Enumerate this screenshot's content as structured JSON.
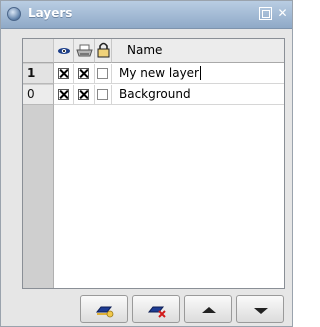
{
  "window": {
    "title": "Layers"
  },
  "table": {
    "columns": {
      "visible_icon": "eye-icon",
      "print_icon": "printer-icon",
      "lock_icon": "lock-icon",
      "name": "Name"
    },
    "rows": [
      {
        "index": "1",
        "visible": true,
        "printable": true,
        "locked": false,
        "name": "My new layer",
        "editing": true,
        "selected": true
      },
      {
        "index": "0",
        "visible": true,
        "printable": true,
        "locked": false,
        "name": "Background",
        "editing": false,
        "selected": false
      }
    ]
  },
  "toolbar": {
    "buttons": [
      "new-layer-icon",
      "delete-layer-icon",
      "arrow-up-icon",
      "arrow-down-icon"
    ]
  }
}
